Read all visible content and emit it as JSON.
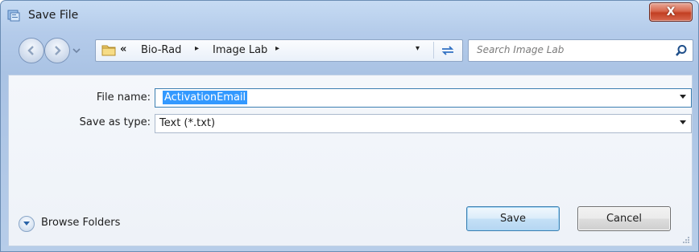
{
  "window": {
    "title": "Save File",
    "close_glyph": "X"
  },
  "nav": {
    "back_icon": "back-arrow-icon",
    "forward_icon": "forward-arrow-icon",
    "history_icon": "chevron-down-icon"
  },
  "address": {
    "overflow": "«",
    "breadcrumbs": [
      "Bio-Rad",
      "Image Lab"
    ],
    "separator": "▸",
    "dropdown": "▾"
  },
  "search": {
    "placeholder": "Search Image Lab"
  },
  "form": {
    "file_name_label": "File name:",
    "file_name_value": "ActivationEmail",
    "save_as_type_label": "Save as type:",
    "save_as_type_value": "Text (*.txt)"
  },
  "footer": {
    "browse_folders_label": "Browse Folders",
    "save_label": "Save",
    "cancel_label": "Cancel"
  },
  "colors": {
    "selection": "#3399ff",
    "close_button": "#c7452a",
    "frame": "#b4cbea"
  }
}
